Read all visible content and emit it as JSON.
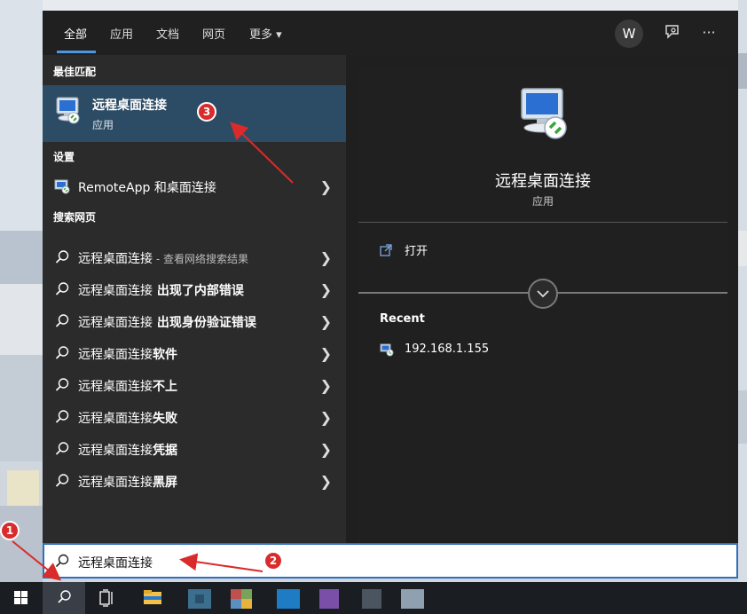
{
  "tabs": [
    {
      "label": "全部"
    },
    {
      "label": "应用"
    },
    {
      "label": "文档"
    },
    {
      "label": "网页"
    },
    {
      "label": "更多"
    }
  ],
  "more_caret": "▾",
  "avatar_letter": "W",
  "overflow_label": "···",
  "best_match": {
    "section": "最佳匹配",
    "title": "远程桌面连接",
    "subtitle": "应用"
  },
  "settings": {
    "section": "设置",
    "item": "RemoteApp 和桌面连接"
  },
  "web": {
    "section": "搜索网页",
    "items": [
      {
        "main": "远程桌面连接",
        "rest": " - 查看网络搜索结果",
        "rest_style": "suffix"
      },
      {
        "main": "远程桌面连接",
        "rest": " 出现了内部错误",
        "rest_style": "bold"
      },
      {
        "main": "远程桌面连接",
        "rest": " 出现身份验证错误",
        "rest_style": "bold"
      },
      {
        "main": "远程桌面连接",
        "rest": "软件",
        "rest_style": "bold"
      },
      {
        "main": "远程桌面连接",
        "rest": "不上",
        "rest_style": "bold"
      },
      {
        "main": "远程桌面连接",
        "rest": "失败",
        "rest_style": "bold"
      },
      {
        "main": "远程桌面连接",
        "rest": "凭据",
        "rest_style": "bold"
      },
      {
        "main": "远程桌面连接",
        "rest": "黑屏",
        "rest_style": "bold"
      }
    ]
  },
  "detail": {
    "title": "远程桌面连接",
    "subtitle": "应用",
    "open_label": "打开",
    "recent_label": "Recent",
    "recent_item": "192.168.1.155"
  },
  "search": {
    "query": "远程桌面连接"
  },
  "annotations": [
    "1",
    "2",
    "3"
  ],
  "colors": {
    "accent": "#4f95e0",
    "highlight": "#2c4b64",
    "annotation": "#d92b2b"
  }
}
